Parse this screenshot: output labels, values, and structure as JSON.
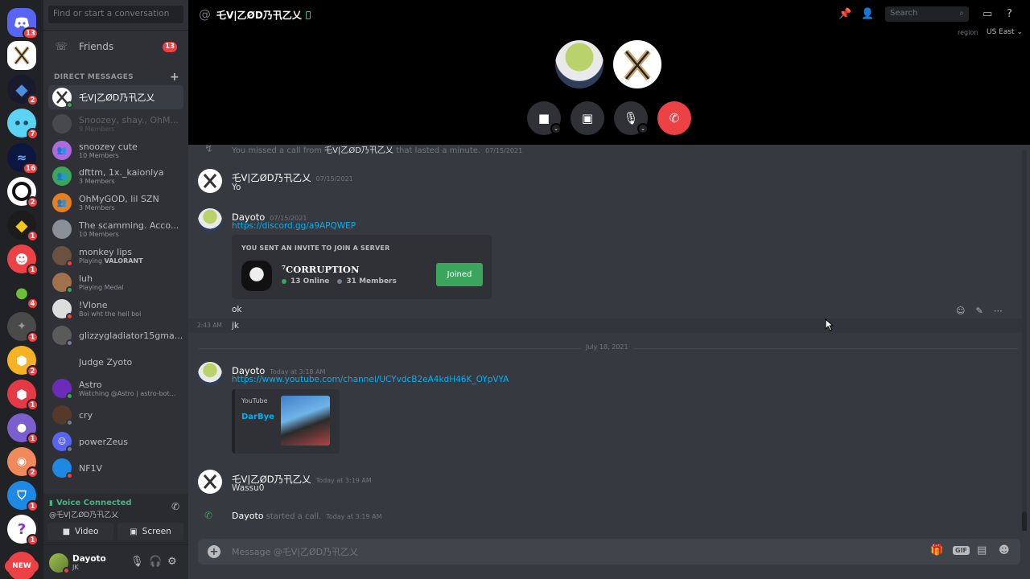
{
  "colors": {
    "blurple": "#5865f2",
    "online": "#3ba55d",
    "dnd": "#ed4245",
    "idle": "#faa81a",
    "link": "#00b0f4"
  },
  "rail": {
    "badges": [
      "13",
      "2",
      "7",
      "16",
      "2",
      "1",
      "1",
      "4",
      "1",
      "2",
      "1",
      "1",
      "2",
      "1",
      "1",
      "1"
    ],
    "new_label": "NEW"
  },
  "sidebar": {
    "search_placeholder": "Find or start a conversation",
    "friends_label": "Friends",
    "friends_badge": "13",
    "dm_header": "DIRECT MESSAGES",
    "dms": [
      {
        "name": "乇V|乙ØD乃卂乙乂",
        "sub": ""
      },
      {
        "name": "Snoozey, shay., OhM...",
        "sub": "9 Members"
      },
      {
        "name": "snoozey cute",
        "sub": "10 Members"
      },
      {
        "name": "dfttm, 1x._kaionlya",
        "sub": "3 Members"
      },
      {
        "name": "OhMyGOD, lil SZN",
        "sub": "3 Members"
      },
      {
        "name": "The scamming. Acco...",
        "sub": "10 Members"
      },
      {
        "name": "monkey lips",
        "sub_prefix": "Playing ",
        "sub_bold": "VALORANT"
      },
      {
        "name": "luh",
        "sub": "Playing Medal"
      },
      {
        "name": "!Vlone",
        "sub": "Boi wht the hell boi"
      },
      {
        "name": "glizzygladiator15gma...",
        "sub": ""
      },
      {
        "name": "Judge Zyoto",
        "sub": ""
      },
      {
        "name": "Astro",
        "sub": "Watching @Astro | astro-bot..."
      },
      {
        "name": "cry",
        "sub": ""
      },
      {
        "name": "powerZeus",
        "sub": ""
      },
      {
        "name": "NF1V",
        "sub": ""
      }
    ],
    "voice": {
      "status": "Voice Connected",
      "channel": "@乇V|乙ØD乃卂乙乂",
      "video_label": "Video",
      "screen_label": "Screen"
    },
    "user": {
      "name": "Dayoto",
      "tag": "JK"
    }
  },
  "header": {
    "channel": "乇V|乙ØD乃卂乙乂",
    "search_placeholder": "Search",
    "region_label": "region",
    "region_value": "US East ⌄"
  },
  "messages": {
    "missed_call": {
      "prefix": "You missed a call from ",
      "name": "乇V|乙ØD乃卂乙乂",
      "suffix": " that lasted a minute.",
      "ts": "07/15/2021"
    },
    "m1": {
      "author": "乇V|乙ØD乃卂乙乂",
      "ts": "07/15/2021",
      "text": "Yo"
    },
    "m2": {
      "author": "Dayoto",
      "ts": "07/15/2021",
      "link": "https://discord.gg/a9APQWEP"
    },
    "invite": {
      "heading": "YOU SENT AN INVITE TO JOIN A SERVER",
      "server": "⁷CORRUPTION",
      "online": "13 Online",
      "members": "31 Members",
      "button": "Joined"
    },
    "ok": "ok",
    "jk": "jk",
    "jk_ts": "2:43 AM",
    "date_divider": "July 18, 2021",
    "m3": {
      "author": "Dayoto",
      "ts": "Today at 3:18 AM",
      "link": "https://www.youtube.com/channel/UCYvdcB2eA4kdH46K_OYpVYA"
    },
    "yt": {
      "provider": "YouTube",
      "title": "DarBye"
    },
    "m4": {
      "author": "乇V|乙ØD乃卂乙乂",
      "ts": "Today at 3:19 AM",
      "text": "Wassu0"
    },
    "call": {
      "author": "Dayoto",
      "text": " started a call.",
      "ts": "Today at 3:19 AM"
    }
  },
  "composer": {
    "placeholder": "Message @乇V|乙ØD乃卂乙乂",
    "gif_label": "GIF"
  }
}
